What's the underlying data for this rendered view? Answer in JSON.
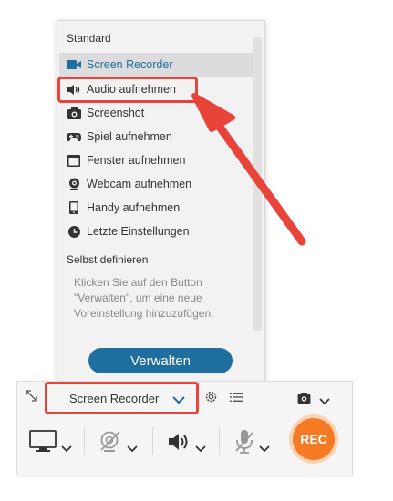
{
  "menu": {
    "section_standard": "Standard",
    "items": [
      {
        "label": "Screen Recorder",
        "icon": "video-camera-icon"
      },
      {
        "label": "Audio aufnehmen",
        "icon": "speaker-icon"
      },
      {
        "label": "Screenshot",
        "icon": "camera-icon"
      },
      {
        "label": "Spiel aufnehmen",
        "icon": "gamepad-icon"
      },
      {
        "label": "Fenster aufnehmen",
        "icon": "window-icon"
      },
      {
        "label": "Webcam aufnehmen",
        "icon": "webcam-icon"
      },
      {
        "label": "Handy aufnehmen",
        "icon": "phone-icon"
      },
      {
        "label": "Letzte Einstellungen",
        "icon": "clock-icon"
      }
    ],
    "section_custom": "Selbst definieren",
    "hint": "Klicken Sie auf den Button \"Verwalten\", um eine neue Voreinstellung hinzuzufügen.",
    "manage_button": "Verwalten"
  },
  "toolbar": {
    "preset_value": "Screen Recorder",
    "rec_label": "REC"
  },
  "colors": {
    "accent": "#1e6f9f",
    "highlight": "#e8443a",
    "rec": "#f47b24"
  }
}
